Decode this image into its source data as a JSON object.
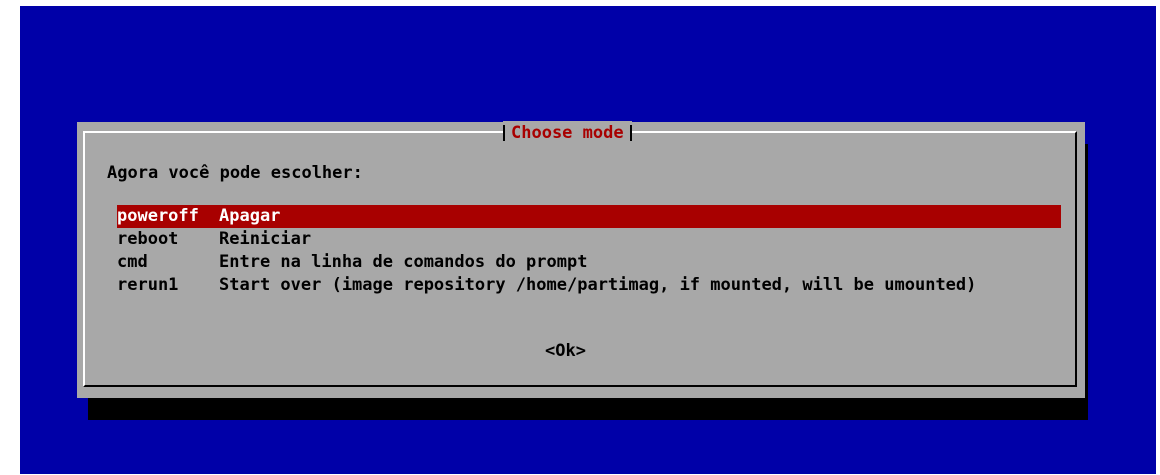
{
  "dialog": {
    "title": "Choose mode",
    "prompt": "Agora você pode escolher:",
    "items": [
      {
        "tag": "poweroff",
        "description": "Apagar",
        "selected": true
      },
      {
        "tag": "reboot",
        "description": "Reiniciar",
        "selected": false
      },
      {
        "tag": "cmd",
        "description": "Entre na linha de comandos do prompt",
        "selected": false
      },
      {
        "tag": "rerun1",
        "description": "Start over (image repository /home/partimag, if mounted, will be umounted)",
        "selected": false
      }
    ],
    "ok_label": "<Ok>"
  },
  "colors": {
    "background": "#0000a8",
    "dialog": "#a8a8a8",
    "highlight": "#a80000",
    "title": "#a80000"
  }
}
